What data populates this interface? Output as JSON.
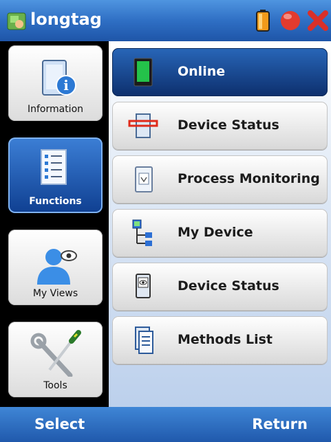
{
  "app": {
    "title": "longtag"
  },
  "softkeys": {
    "left": "Select",
    "right": "Return"
  },
  "left_nav": [
    {
      "label": "Information",
      "icon": "information-icon",
      "selected": false
    },
    {
      "label": "Functions",
      "icon": "functions-list-icon",
      "selected": true
    },
    {
      "label": "My Views",
      "icon": "user-views-icon",
      "selected": false
    },
    {
      "label": "Tools",
      "icon": "tools-icon",
      "selected": false
    }
  ],
  "menu": [
    {
      "label": "Online",
      "icon": "online-device-icon",
      "selected": true
    },
    {
      "label": "Device Status",
      "icon": "device-status-icon",
      "selected": false
    },
    {
      "label": "Process Monitoring",
      "icon": "process-monitoring-icon",
      "selected": false
    },
    {
      "label": "My Device",
      "icon": "device-tree-icon",
      "selected": false
    },
    {
      "label": "Device Status",
      "icon": "device-view-icon",
      "selected": false
    },
    {
      "label": "Methods List",
      "icon": "methods-list-icon",
      "selected": false
    }
  ],
  "system_icons": [
    "battery-icon",
    "record-icon",
    "close-icon"
  ],
  "colors": {
    "title_bar": "#2f6fc4",
    "selected": "#0f3f91",
    "battery": "#e07a00",
    "record": "#e23b2e",
    "close": "#d9302a"
  }
}
